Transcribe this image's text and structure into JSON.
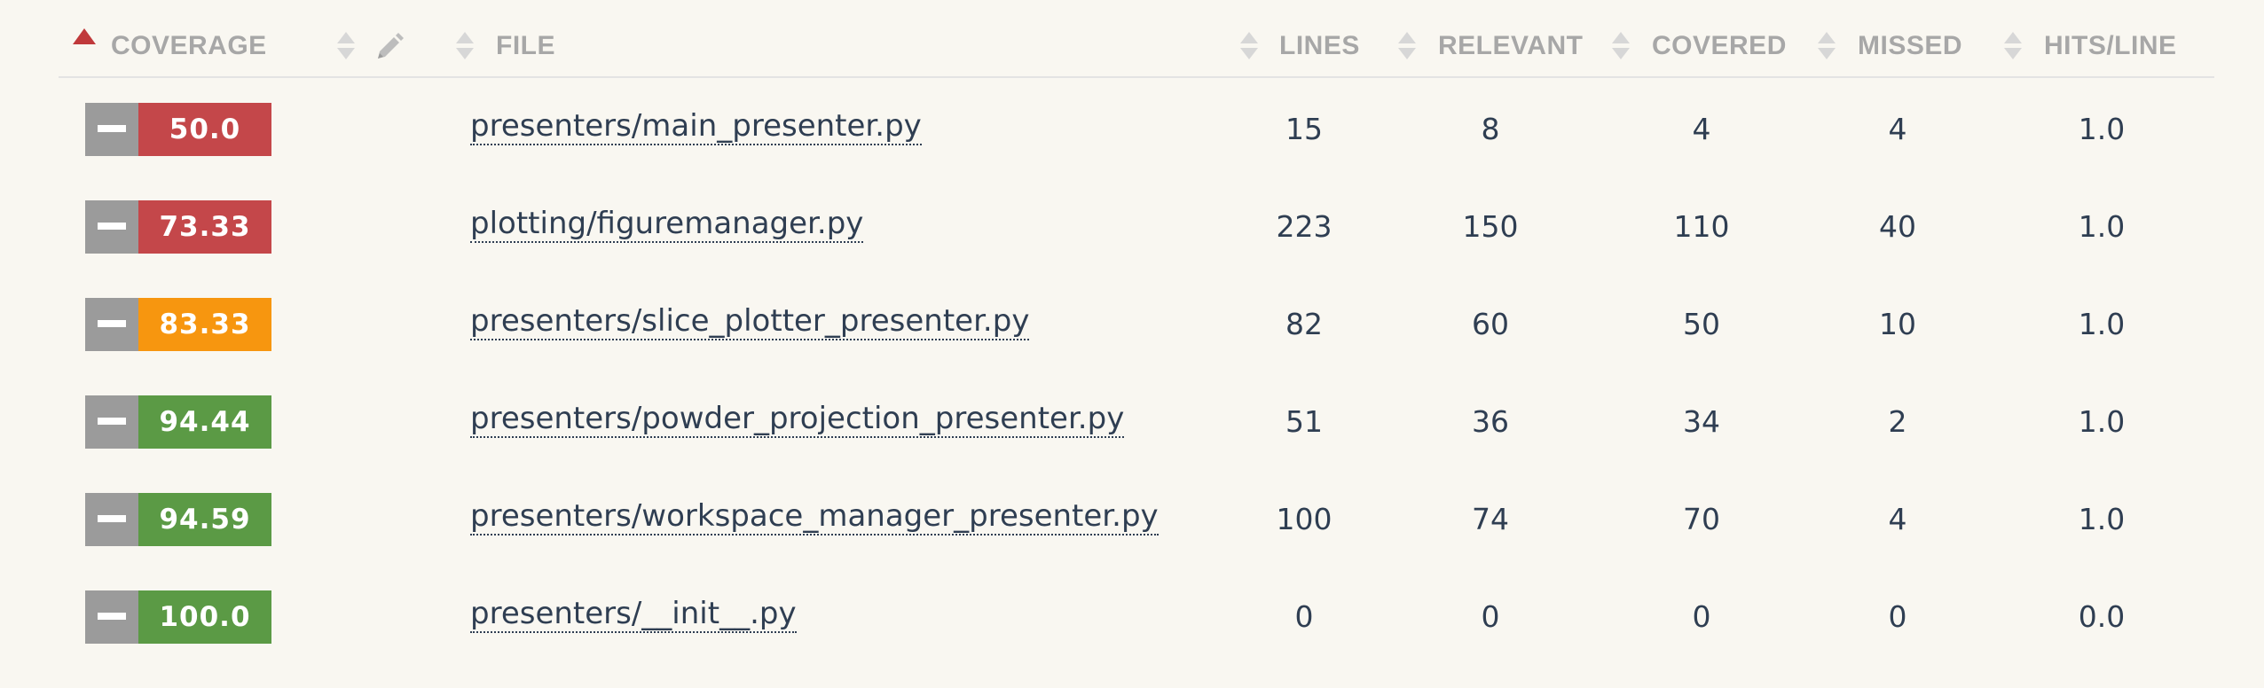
{
  "colors": {
    "low": "#c4474a",
    "medium": "#f7960f",
    "high": "#5b9a45",
    "toggle": "#9b9b9b",
    "sort_active": "#c0393b"
  },
  "header": {
    "coverage": "COVERAGE",
    "file": "FILE",
    "lines": "LINES",
    "relevant": "RELEVANT",
    "covered": "COVERED",
    "missed": "MISSED",
    "hits_per_line": "HITS/LINE"
  },
  "rows": [
    {
      "coverage": "50.0",
      "level": "low",
      "file": "presenters/main_presenter.py",
      "lines": "15",
      "relevant": "8",
      "covered": "4",
      "missed": "4",
      "hits": "1.0"
    },
    {
      "coverage": "73.33",
      "level": "low",
      "file": "plotting/figuremanager.py",
      "lines": "223",
      "relevant": "150",
      "covered": "110",
      "missed": "40",
      "hits": "1.0"
    },
    {
      "coverage": "83.33",
      "level": "medium",
      "file": "presenters/slice_plotter_presenter.py",
      "lines": "82",
      "relevant": "60",
      "covered": "50",
      "missed": "10",
      "hits": "1.0"
    },
    {
      "coverage": "94.44",
      "level": "high",
      "file": "presenters/powder_projection_presenter.py",
      "lines": "51",
      "relevant": "36",
      "covered": "34",
      "missed": "2",
      "hits": "1.0"
    },
    {
      "coverage": "94.59",
      "level": "high",
      "file": "presenters/workspace_manager_presenter.py",
      "lines": "100",
      "relevant": "74",
      "covered": "70",
      "missed": "4",
      "hits": "1.0"
    },
    {
      "coverage": "100.0",
      "level": "high",
      "file": "presenters/__init__.py",
      "lines": "0",
      "relevant": "0",
      "covered": "0",
      "missed": "0",
      "hits": "0.0"
    }
  ]
}
